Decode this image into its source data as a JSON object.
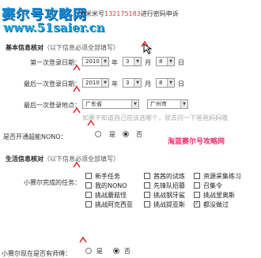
{
  "banner": {
    "brand": "赛尔号攻略网",
    "url": "www.51saier.cn",
    "watermark": "淘蓝赛尔号攻略网"
  },
  "header": {
    "prefix": "为米米号",
    "account": "132175183",
    "suffix": "进行密码申诉"
  },
  "basic": {
    "title": "基本信息核对",
    "note": "（以下信息必须全部填写）",
    "first_login_label": "第一次登录日期：",
    "first_login": {
      "year": "2010",
      "month": "3",
      "day": "8"
    },
    "last_login_label": "最后一次登录日期：",
    "last_login": {
      "year": "2010",
      "month": "3",
      "day": "8"
    },
    "last_place_label": "最后一次登录地点：",
    "province": "广东省",
    "city": "广州市",
    "place_hint": "如果不知道自己应该选哪个，就去问一下爸爸妈妈哦",
    "super_nono_label": "是否开通超能NONO：",
    "yes": "是",
    "no": "否",
    "unit_year": "年",
    "unit_month": "月",
    "unit_day": "日"
  },
  "life": {
    "title": "生活信息核对",
    "note": "（以下信息必须全部填写）",
    "tasks_label": "小赛尔完成的任务：",
    "tasks": [
      {
        "label": "新手任务",
        "checked": false
      },
      {
        "label": "茜茜的试炼",
        "checked": false
      },
      {
        "label": "资源采集练习",
        "checked": false
      },
      {
        "label": "我的NONO",
        "checked": false
      },
      {
        "label": "先锋队招募",
        "checked": false
      },
      {
        "label": "召集令",
        "checked": false
      },
      {
        "label": "挑战蘑菇怪",
        "checked": false
      },
      {
        "label": "挑战钢牙鲨",
        "checked": false
      },
      {
        "label": "挑战里奥斯",
        "checked": false
      },
      {
        "label": "挑战阿克西亚",
        "checked": false
      },
      {
        "label": "挑战提亚斯",
        "checked": false
      },
      {
        "label": "都没做过",
        "checked": true
      }
    ],
    "mentor_label": "小赛尔现在是否有师傅：",
    "yes": "是",
    "no": "否"
  }
}
